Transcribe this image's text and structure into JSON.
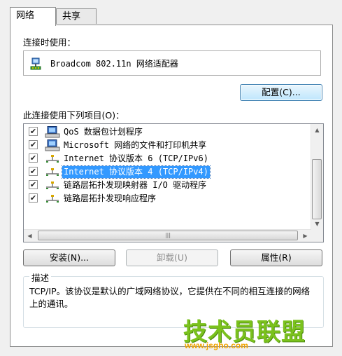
{
  "tabs": [
    {
      "label": "网络",
      "active": true
    },
    {
      "label": "共享",
      "active": false
    }
  ],
  "connect_using_label": "连接时使用：",
  "adapter": {
    "name": "Broadcom 802.11n 网络适配器",
    "icon": "network-adapter-icon"
  },
  "configure_button": "配置(C)...",
  "items_label": "此连接使用下列项目(O)：",
  "items": [
    {
      "label": "QoS 数据包计划程序",
      "checked": true,
      "icon": "network-service-icon",
      "selected": false
    },
    {
      "label": "Microsoft 网络的文件和打印机共享",
      "checked": true,
      "icon": "network-service-icon",
      "selected": false
    },
    {
      "label": "Internet 协议版本 6 (TCP/IPv6)",
      "checked": true,
      "icon": "protocol-icon",
      "selected": false
    },
    {
      "label": "Internet 协议版本 4 (TCP/IPv4)",
      "checked": true,
      "icon": "protocol-icon",
      "selected": true
    },
    {
      "label": "链路层拓扑发现映射器 I/O 驱动程序",
      "checked": true,
      "icon": "protocol-icon",
      "selected": false
    },
    {
      "label": "链路层拓扑发现响应程序",
      "checked": true,
      "icon": "protocol-icon",
      "selected": false
    }
  ],
  "buttons": {
    "install": "安装(N)...",
    "uninstall": "卸载(U)",
    "properties": "属性(R)"
  },
  "description": {
    "title": "描述",
    "text": "TCP/IP。该协议是默认的广域网络协议，它提供在不同的相互连接的网络上的通讯。"
  },
  "watermark": {
    "title": "技术员联盟",
    "url": "www.jsgho.com"
  },
  "colors": {
    "selection": "#3399ff",
    "watermark_green": "#7bc21d",
    "watermark_orange": "#f0a400"
  }
}
